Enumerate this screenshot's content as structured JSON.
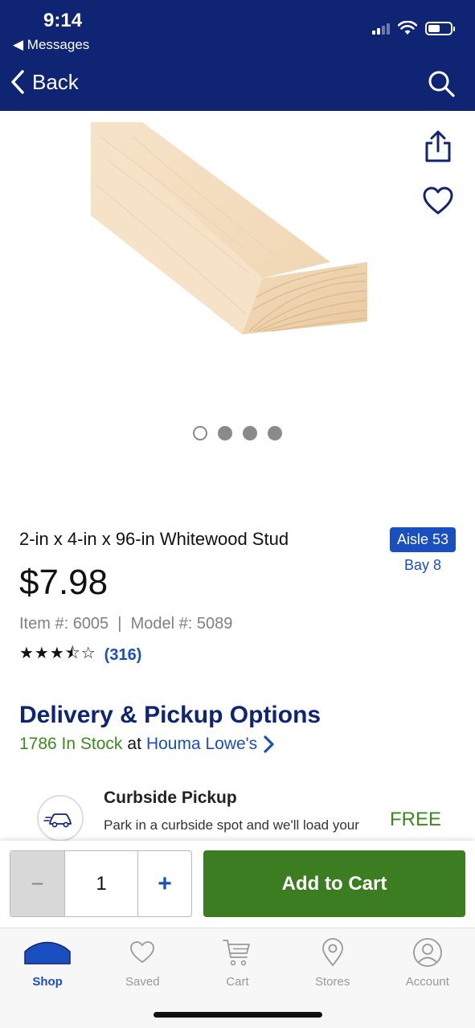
{
  "status_bar": {
    "time": "9:14",
    "back_app": "◀ Messages"
  },
  "nav": {
    "back_label": "Back",
    "back_icon": "chevron-left-icon",
    "search_icon": "search-icon"
  },
  "gallery": {
    "image": "whitewood-stud-image",
    "page_count": 4,
    "active_index": 0
  },
  "product": {
    "title": "2-in x 4-in x 96-in Whitewood Stud",
    "aisle": "Aisle 53",
    "bay": "Bay 8",
    "price": "$7.98",
    "item_model": "Item #: 6005  |  Model #: 5089",
    "rating_stars": "★★★⯪☆",
    "rating_value": 3.5,
    "reviews": "(316)"
  },
  "delivery": {
    "title": "Delivery & Pickup Options",
    "in_stock": "1786 In Stock",
    "at": "at",
    "store": "Houma Lowe's",
    "curbside": {
      "title": "Curbside Pickup",
      "description": "Park in a curbside spot and we'll load your car.",
      "price": "FREE"
    }
  },
  "cart_bar": {
    "minus": "−",
    "quantity": "1",
    "plus": "+",
    "add_label": "Add to Cart"
  },
  "tabs": [
    {
      "label": "Shop",
      "icon": "shop-icon",
      "active": true
    },
    {
      "label": "Saved",
      "icon": "heart-icon",
      "active": false
    },
    {
      "label": "Cart",
      "icon": "cart-icon",
      "active": false
    },
    {
      "label": "Stores",
      "icon": "location-pin-icon",
      "active": false
    },
    {
      "label": "Account",
      "icon": "user-icon",
      "active": false
    }
  ],
  "colors": {
    "nav_bg": "#0f2473",
    "accent_blue": "#1a4fc0",
    "green": "#3d7d21",
    "stock_green": "#3a8a1e"
  }
}
